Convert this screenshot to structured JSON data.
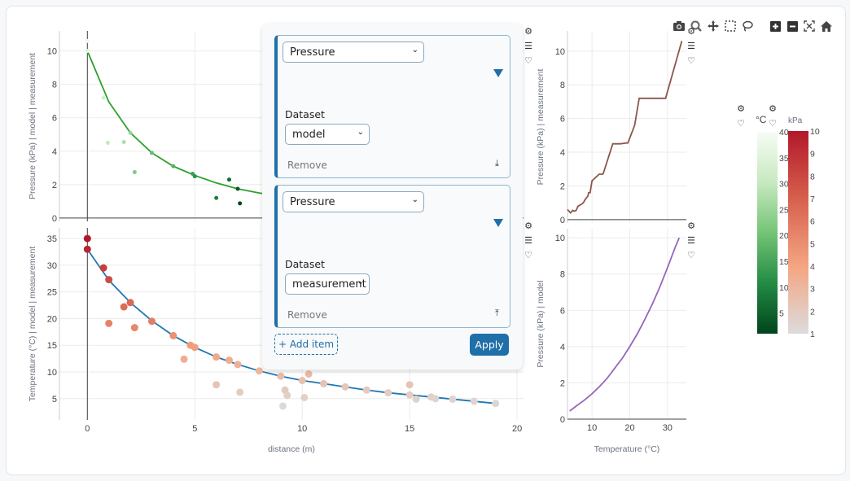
{
  "toolbar": {
    "icons": [
      "camera-icon",
      "zoom-icon",
      "pan-icon",
      "box-select-icon",
      "lasso-select-icon",
      "zoom-in-icon",
      "zoom-out-icon",
      "autoscale-icon",
      "reset-axes-icon"
    ],
    "glyphs": [
      "📷",
      "🔍",
      "✥",
      "⬚",
      "◯",
      "＋",
      "－",
      "⤢",
      "⌂"
    ]
  },
  "panel": {
    "items": [
      {
        "variable": "Pressure",
        "dataset_label": "Dataset",
        "dataset": "model",
        "remove_label": "Remove",
        "pin_glyph": "⤓"
      },
      {
        "variable": "Pressure",
        "dataset_label": "Dataset",
        "dataset": "measurement",
        "remove_label": "Remove",
        "pin_glyph": "⤒"
      }
    ],
    "add_label": "+ Add item",
    "apply_label": "Apply"
  },
  "mini_icons": {
    "gear": "⚙",
    "list": "☰",
    "heart": "♡"
  },
  "chart_data": [
    {
      "type": "scatter",
      "name": "pressure-vs-distance",
      "ylabel": "Pressure (kPa) | model | measurement",
      "xlabel": "",
      "xlim": [
        -1.3,
        20.3
      ],
      "ylim": [
        -0.2,
        11.2
      ],
      "yticks": [
        0,
        2,
        4,
        6,
        8,
        10
      ],
      "xticks": [
        0,
        5,
        10,
        15,
        20
      ],
      "line": {
        "color": "#2ca02c",
        "x": [
          0,
          1,
          2,
          3,
          4,
          5,
          6,
          7,
          8,
          9,
          10,
          11,
          12,
          13,
          14,
          15,
          16,
          17,
          18,
          19
        ],
        "y": [
          10,
          6.95,
          5.1,
          3.9,
          3.1,
          2.55,
          2.1,
          1.75,
          1.5,
          1.3,
          1.15,
          1.02,
          0.92,
          0.84,
          0.77,
          0.71,
          0.66,
          0.62,
          0.58,
          0.55
        ]
      },
      "points": {
        "x": [
          0,
          0,
          0.75,
          0.95,
          1.7,
          2.0,
          2.2,
          3.0,
          4.0,
          4.9,
          5.0,
          6.0,
          6.6,
          7.0,
          7.1
        ],
        "y": [
          10.6,
          10.0,
          7.2,
          4.5,
          4.55,
          5.1,
          2.75,
          3.9,
          3.1,
          2.65,
          2.5,
          1.2,
          2.3,
          1.75,
          0.88
        ],
        "color_var": "°C"
      }
    },
    {
      "type": "scatter",
      "name": "temperature-vs-distance",
      "ylabel": "Temperature (°C) | model | measurement",
      "xlabel": "distance (m)",
      "xlim": [
        -1.3,
        20.3
      ],
      "ylim": [
        1,
        37
      ],
      "yticks": [
        5,
        10,
        15,
        20,
        25,
        30,
        35
      ],
      "xticks": [
        0,
        5,
        10,
        15,
        20
      ],
      "line": {
        "color": "#1f77b4",
        "x": [
          0,
          1,
          2,
          3,
          4,
          5,
          6,
          7,
          8,
          9,
          10,
          11,
          12,
          13,
          14,
          15,
          16,
          17,
          18,
          19
        ],
        "y": [
          33,
          27.2,
          23,
          19.6,
          16.8,
          14.6,
          12.8,
          11.4,
          10.2,
          9.2,
          8.4,
          7.8,
          7.2,
          6.6,
          6.1,
          5.7,
          5.3,
          4.9,
          4.5,
          4.1
        ]
      },
      "points": {
        "x": [
          0,
          0,
          0.75,
          1.0,
          1.7,
          2.0,
          1.0,
          2.2,
          3.0,
          4.0,
          4.8,
          5.0,
          4.5,
          6.0,
          6.6,
          7.0,
          8.0,
          6.0,
          7.1,
          9.0,
          10.0,
          10.3,
          9.2,
          9.3,
          9.1,
          10.1,
          11.0,
          12.0,
          13.0,
          14.0,
          15.0,
          15.0,
          15.3,
          16.0,
          16.2,
          17.0,
          18.0,
          19.0
        ],
        "y": [
          35,
          33,
          29.5,
          27.3,
          22.2,
          23,
          19.1,
          18.3,
          19.5,
          16.8,
          15,
          14.6,
          12.4,
          12.8,
          12.2,
          11.4,
          10.2,
          7.6,
          6.2,
          9.2,
          8.4,
          9.6,
          6.6,
          5.6,
          3.6,
          5.2,
          7.8,
          7.2,
          6.6,
          6.1,
          5.7,
          7.6,
          4.9,
          5.3,
          5.0,
          4.9,
          4.5,
          4.1
        ],
        "color_var": "kPa"
      }
    },
    {
      "type": "line",
      "name": "pressure-vs-temperature-measurement",
      "ylabel": "Pressure (kPa) | measurement",
      "xlim": [
        3.5,
        35
      ],
      "ylim": [
        -0.2,
        11.2
      ],
      "yticks": [
        0,
        2,
        4,
        6,
        8,
        10
      ],
      "line": {
        "color": "#8c564b",
        "x": [
          3.5,
          4.3,
          4.9,
          5.3,
          5.8,
          6.3,
          7.1,
          7.7,
          8.2,
          8.9,
          9.1,
          9.5,
          10.0,
          11.9,
          12.8,
          13.0,
          15.5,
          17.5,
          19.2,
          19.5,
          21.3,
          22.5,
          29.5,
          33.8
        ],
        "y": [
          0.6,
          0.4,
          0.55,
          0.5,
          0.55,
          0.8,
          0.9,
          1.0,
          1.2,
          1.4,
          1.6,
          1.6,
          2.3,
          2.7,
          2.7,
          2.75,
          4.5,
          4.5,
          4.55,
          4.55,
          5.6,
          7.2,
          7.2,
          10.6
        ]
      }
    },
    {
      "type": "line",
      "name": "pressure-vs-temperature-model",
      "ylabel": "Pressure (kPa) | model",
      "xlabel": "Temperature (°C)",
      "xlim": [
        3.5,
        35
      ],
      "ylim": [
        0,
        10.5
      ],
      "yticks": [
        0,
        2,
        4,
        6,
        8,
        10
      ],
      "xticks": [
        10,
        20,
        30
      ],
      "line": {
        "color": "#9467bd",
        "x": [
          4.1,
          6,
          8,
          10,
          12,
          14,
          16,
          18,
          20,
          22,
          24,
          26,
          28,
          30,
          32,
          33.1
        ],
        "y": [
          0.45,
          0.75,
          1.05,
          1.4,
          1.8,
          2.25,
          2.8,
          3.35,
          4.0,
          4.7,
          5.5,
          6.35,
          7.3,
          8.35,
          9.45,
          10.0
        ]
      }
    }
  ],
  "colorbars": [
    {
      "title": "°C",
      "min": 1,
      "max": 40,
      "ticks": [
        "5",
        "10",
        "15",
        "20",
        "25",
        "30",
        "35",
        "40"
      ],
      "colors": [
        "#00441b",
        "#238b45",
        "#74c476",
        "#c7e9c0",
        "#f7fcf5"
      ]
    },
    {
      "title": "kPa",
      "min": 1,
      "max": 10,
      "ticks": [
        "1",
        "2",
        "3",
        "4",
        "5",
        "6",
        "7",
        "8",
        "9",
        "10"
      ],
      "colors": [
        "#dcdcdc",
        "#f4a582",
        "#d6604d",
        "#b2182b"
      ]
    }
  ]
}
